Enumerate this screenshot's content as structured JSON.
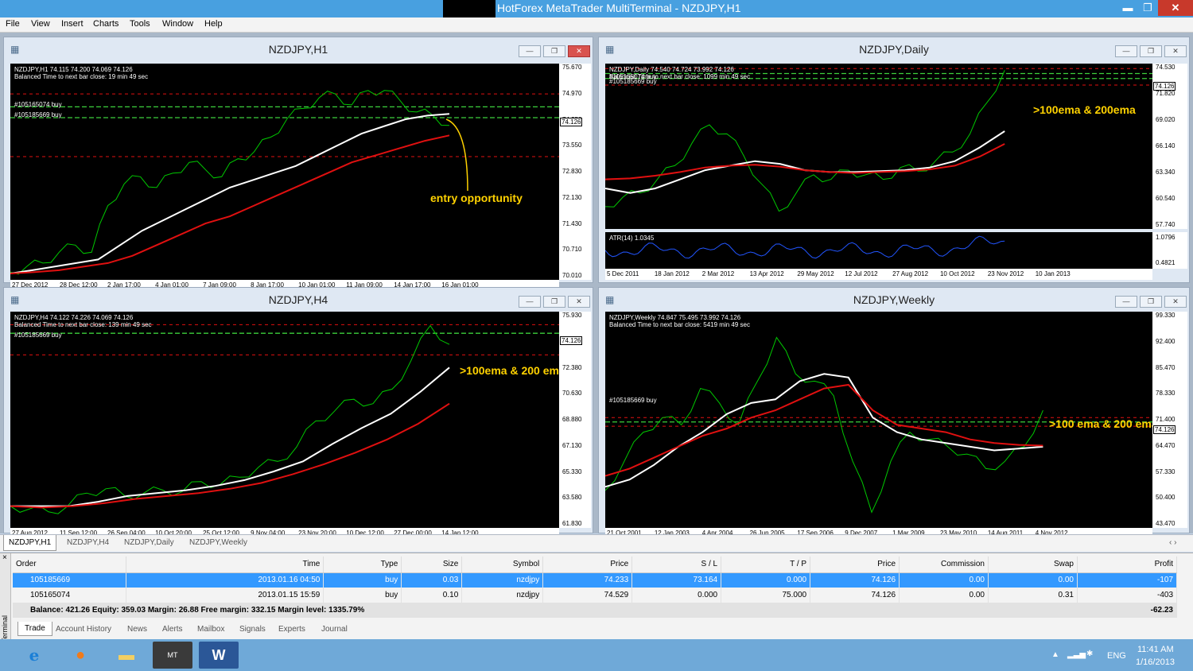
{
  "window": {
    "title": "HotForex MetaTrader MultiTerminal - NZDJPY,H1",
    "min": "▬",
    "max": "❐",
    "close": "✕"
  },
  "menu": [
    "File",
    "View",
    "Insert",
    "Charts",
    "Tools",
    "Window",
    "Help"
  ],
  "charts": [
    {
      "title": "NZDJPY,H1",
      "info1": "NZDJPY,H1  74.115 74.200 74.069 74.126",
      "info2": "Balanced Time to next bar close: 19 min 49 sec",
      "orders": [
        "#105165074 buy",
        "#105185669 buy"
      ],
      "yticks": [
        "75.670",
        "74.970",
        "74.250",
        "73.550",
        "72.830",
        "72.130",
        "71.430",
        "70.710",
        "70.010"
      ],
      "current_price": "74.126",
      "xticks": [
        "27 Dec 2012",
        "28 Dec 12:00",
        "2 Jan 17:00",
        "4 Jan 01:00",
        "7 Jan 09:00",
        "8 Jan 17:00",
        "10 Jan 01:00",
        "11 Jan 09:00",
        "14 Jan 17:00",
        "16 Jan 01:00"
      ],
      "annotation": "entry opportunity",
      "chart_data": {
        "type": "line",
        "series": [
          {
            "values": [
              70.05,
              70.2,
              70.3,
              70.6,
              70.8,
              70.6,
              71.9,
              72.5,
              72.7,
              72.4,
              72.8,
              73.1,
              72.9,
              72.7,
              73.2,
              73.4,
              73.8,
              74.3,
              74.6,
              74.9,
              75.0,
              74.7,
              75.1,
              75.1,
              74.8,
              74.5,
              74.4,
              74.13
            ]
          },
          {
            "values": [
              70.01,
              70.1,
              70.2,
              70.3,
              70.4,
              70.8,
              71.2,
              71.5,
              71.8,
              72.1,
              72.4,
              72.6,
              72.8,
              73.0,
              73.3,
              73.6,
              73.9,
              74.1,
              74.3,
              74.4,
              74.45
            ]
          },
          {
            "values": [
              70.01,
              70.05,
              70.1,
              70.2,
              70.3,
              70.5,
              70.8,
              71.1,
              71.4,
              71.6,
              71.9,
              72.2,
              72.5,
              72.8,
              73.1,
              73.3,
              73.5,
              73.7,
              73.85
            ]
          }
        ],
        "ylim": [
          70.01,
          75.67
        ]
      }
    },
    {
      "title": "NZDJPY,Daily",
      "info1": "NZDJPY,Daily  74.540 74.724 73.992 74.126",
      "info2": "Balanced Time to next bar close: 1099 min 49 sec",
      "orders": [
        "#105165074 buy",
        "#105185669 buy"
      ],
      "yticks": [
        "74.530",
        "71.820",
        "69.020",
        "66.140",
        "63.340",
        "60.540",
        "57.740"
      ],
      "current_price": "74.126",
      "atr_label": "ATR(14) 1.0345",
      "atr_ticks": [
        "1.0796",
        "0.4821"
      ],
      "xticks": [
        "5 Dec 2011",
        "18 Jan 2012",
        "2 Mar 2012",
        "13 Apr 2012",
        "29 May 2012",
        "12 Jul 2012",
        "27 Aug 2012",
        "10 Oct 2012",
        "23 Nov 2012",
        "10 Jan 2013"
      ],
      "annotation": ">100ema & 200ema",
      "chart_data": {
        "type": "line",
        "series": [
          {
            "values": [
              59.5,
              60.5,
              61.0,
              62.5,
              64.0,
              66.5,
              68.5,
              67.5,
              65.0,
              62.0,
              59.0,
              61.0,
              63.0,
              62.5,
              63.5,
              63.0,
              62.5,
              63.8,
              63.4,
              64.5,
              65.5,
              67.5,
              71.0,
              74.5
            ]
          },
          {
            "values": [
              61.5,
              61.0,
              61.5,
              62.5,
              63.5,
              64.0,
              64.5,
              64.2,
              63.5,
              63.3,
              63.3,
              63.4,
              63.5,
              63.8,
              64.5,
              66.0,
              67.8
            ]
          },
          {
            "values": [
              62.5,
              62.6,
              62.9,
              63.3,
              63.8,
              64.0,
              64.1,
              63.9,
              63.5,
              63.3,
              63.2,
              63.3,
              63.4,
              63.6,
              64.0,
              65.0,
              66.4
            ]
          }
        ],
        "ylim": [
          57.74,
          74.53
        ]
      }
    },
    {
      "title": "NZDJPY,H4",
      "info1": "NZDJPY,H4  74.122 74.226 74.069 74.126",
      "info2": "Balanced Time to next bar close: 139 min 49 sec",
      "orders": [
        "#105185669 buy"
      ],
      "yticks": [
        "75.930",
        "74.130",
        "72.380",
        "70.630",
        "68.880",
        "67.130",
        "65.330",
        "63.580",
        "61.830"
      ],
      "current_price": "74.126",
      "xticks": [
        "27 Aug 2012",
        "11 Sep 12:00",
        "26 Sep 04:00",
        "10 Oct 20:00",
        "25 Oct 12:00",
        "9 Nov 04:00",
        "23 Nov 20:00",
        "10 Dec 12:00",
        "27 Dec 00:00",
        "14 Jan 12:00"
      ],
      "annotation": ">100ema & 200 ema",
      "chart_data": {
        "type": "line",
        "series": [
          {
            "values": [
              62.9,
              62.7,
              62.5,
              62.9,
              63.8,
              64.1,
              63.6,
              63.8,
              64.0,
              63.9,
              64.6,
              64.4,
              64.9,
              65.6,
              66.0,
              67.0,
              68.8,
              69.5,
              70.3,
              70.0,
              71.0,
              73.0,
              75.4,
              74.1
            ]
          },
          {
            "values": [
              62.9,
              62.9,
              62.9,
              63.2,
              63.6,
              63.8,
              64.0,
              64.3,
              64.7,
              65.3,
              66.0,
              67.2,
              68.3,
              69.3,
              70.8,
              72.5
            ]
          },
          {
            "values": [
              62.9,
              62.8,
              62.9,
              63.1,
              63.4,
              63.6,
              63.8,
              64.1,
              64.5,
              65.1,
              65.8,
              66.6,
              67.5,
              68.6,
              70.0
            ]
          }
        ],
        "ylim": [
          61.83,
          75.93
        ]
      }
    },
    {
      "title": "NZDJPY,Weekly",
      "info1": "NZDJPY,Weekly  74.847 75.495 73.992 74.126",
      "info2": "Balanced Time to next bar close: 5419 min 49 sec",
      "orders": [
        "#105185669 buy"
      ],
      "yticks": [
        "99.330",
        "92.400",
        "85.470",
        "78.330",
        "71.400",
        "64.470",
        "57.330",
        "50.400",
        "43.470"
      ],
      "current_price": "74.126",
      "xticks": [
        "21 Oct 2001",
        "12 Jan 2003",
        "4 Apr 2004",
        "26 Jun 2005",
        "17 Sep 2006",
        "9 Dec 2007",
        "1 Mar 2009",
        "23 May 2010",
        "14 Aug 2011",
        "4 Nov 2012"
      ],
      "annotation": ">100 ema & 200 ema",
      "chart_data": {
        "type": "line",
        "series": [
          {
            "values": [
              52,
              60,
              68,
              72,
              70,
              80,
              76,
              70,
              82,
              94,
              84,
              82,
              78,
              60,
              46,
              60,
              68,
              66,
              64,
              62,
              58,
              60,
              64,
              74
            ]
          },
          {
            "values": [
              53,
              55,
              59,
              64,
              68,
              73,
              76,
              77,
              82,
              84,
              83,
              72,
              68,
              66,
              65,
              64,
              63,
              63.5,
              64
            ]
          },
          {
            "values": [
              56,
              58,
              61,
              64,
              67,
              69,
              72,
              74,
              77,
              80,
              81,
              74,
              70,
              69,
              68,
              66,
              65,
              64.5,
              64.3
            ]
          }
        ],
        "ylim": [
          43.47,
          99.33
        ]
      }
    }
  ],
  "chart_tabs": [
    "NZDJPY,H1",
    "NZDJPY,H4",
    "NZDJPY,Daily",
    "NZDJPY,Weekly"
  ],
  "terminal": {
    "label": "Terminal",
    "headers": [
      "Order",
      "Time",
      "Type",
      "Size",
      "Symbol",
      "Price",
      "S / L",
      "T / P",
      "Price",
      "Commission",
      "Swap",
      "Profit"
    ],
    "rows": [
      [
        "105185669",
        "2013.01.16 04:50",
        "buy",
        "0.03",
        "nzdjpy",
        "74.233",
        "73.164",
        "0.000",
        "74.126",
        "0.00",
        "0.00",
        "-107"
      ],
      [
        "105165074",
        "2013.01.15 15:59",
        "buy",
        "0.10",
        "nzdjpy",
        "74.529",
        "0.000",
        "75.000",
        "74.126",
        "0.00",
        "0.31",
        "-403"
      ]
    ],
    "balance": "Balance: 421.26  Equity: 359.03  Margin: 26.88  Free margin: 332.15  Margin level: 1335.79%",
    "total": "-62.23",
    "tabs": [
      "Trade",
      "Account History",
      "News",
      "Alerts",
      "Mailbox",
      "Signals",
      "Experts",
      "Journal"
    ]
  },
  "taskbar": {
    "lang": "ENG",
    "time": "11:41 AM",
    "date": "1/16/2013"
  },
  "colors": {
    "price": "#00c800",
    "ema100": "#ffffff",
    "ema200": "#e01010",
    "atr": "#2255ff",
    "annotation": "#ffd200"
  }
}
